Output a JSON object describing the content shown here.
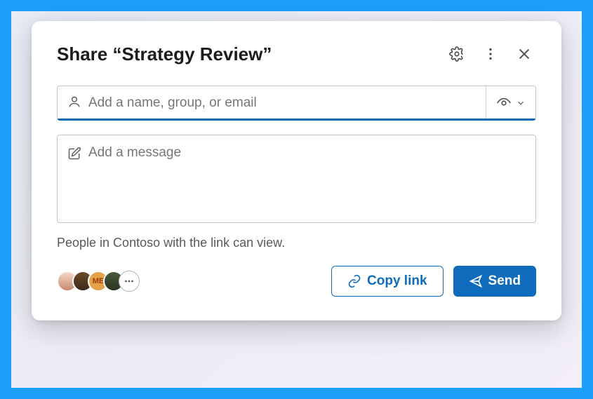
{
  "dialog": {
    "title": "Share “Strategy Review”",
    "recipient_placeholder": "Add a name, group, or email",
    "message_placeholder": "Add a message",
    "permission_text": "People in Contoso with the link can view.",
    "copy_label": "Copy link",
    "send_label": "Send"
  },
  "avatars": {
    "a3_label": "ME"
  }
}
